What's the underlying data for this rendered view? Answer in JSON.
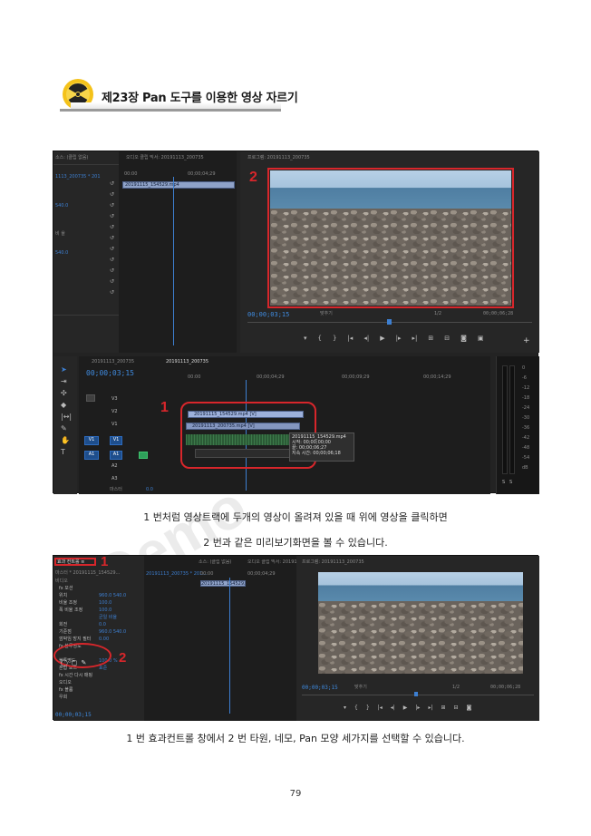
{
  "chapter": {
    "title": "제23장 Pan 도구를 이용한 영상 자르기"
  },
  "screenshot1": {
    "source_panel_tab": "소스: (클립 없음)",
    "audio_mixer_tab": "오디오 클립 믹서: 20191113_200735",
    "program_tab": "프로그램: 20191113_200735",
    "left_list": [
      "1113_200735 * 201",
      "540.0",
      "비 율",
      "540.0"
    ],
    "mini_ruler": [
      "00:00",
      "00;00;04;29"
    ],
    "mini_clip": "20191115_154529.mp4",
    "program_timecode": "00;00;03;15",
    "program_fit": "맞추기",
    "program_res": "1/2",
    "program_duration": "00;00;06;28",
    "timeline_tabs": [
      "20191113_200735",
      "20191113_200735"
    ],
    "timeline_timecode": "00;00;03;15",
    "ruler": [
      "00:00",
      "00;00;04;29",
      "00;00;09;29",
      "00;00;14;29"
    ],
    "tracks": [
      {
        "name": "V3",
        "src": ""
      },
      {
        "name": "V2",
        "src": ""
      },
      {
        "name": "V1",
        "src": "V1"
      },
      {
        "name": "A1",
        "src": "A1"
      },
      {
        "name": "A2",
        "src": ""
      },
      {
        "name": "A3",
        "src": ""
      }
    ],
    "master_label": "마스터",
    "master_value": "0.0",
    "clip_v2": "20191115_154529.mp4 [V]",
    "clip_v1": "20191113_200735.mp4 [V]",
    "tooltip": [
      "20191115_154529.mp4",
      "시작: 00;00;00;00",
      "끝: 00;00;06;27",
      "지속 시간: 00;00;06;18"
    ],
    "meter_scale": [
      "0",
      "-6",
      "-12",
      "-18",
      "-24",
      "-30",
      "-36",
      "-42",
      "-48",
      "-54",
      "dB"
    ],
    "meter_sr": [
      "S",
      "S"
    ],
    "label_1": "1",
    "label_2": "2"
  },
  "caption1_line1": "1 번처럼 영상트랙에 두개의 영상이 올려져 있을 때 위에 영상을 클릭하면",
  "caption1_line2": "2 번과 같은 미리보기화면을 볼 수 있습니다.",
  "screenshot2": {
    "effect_tab": "효과 컨트롤 ≡",
    "source_tab": "소스: (클립 없음)",
    "mixer_tab": "오디오 클립 믹서: 20191113_200735",
    "program_tab": "프로그램: 20191113_200735",
    "clip_path": "마스터 * 20191115_154529...",
    "sequence_path": "20191113_200735 * 201...",
    "ruler": [
      "00:00",
      "00;00;04;29"
    ],
    "clip_name": "20191115_154529.mp4",
    "section_video": "비디오",
    "rows": [
      {
        "label": "fx 모션",
        "value": ""
      },
      {
        "label": "위치",
        "value": "960.0  540.0"
      },
      {
        "label": "비율 조정",
        "value": "100.0"
      },
      {
        "label": "폭 비율 조정",
        "value": "100.0"
      },
      {
        "label": "",
        "value": "균일 비율"
      },
      {
        "label": "회전",
        "value": "0.0"
      },
      {
        "label": "기준점",
        "value": "960.0  540.0"
      },
      {
        "label": "깜박임 방지 필터",
        "value": "0.00"
      },
      {
        "label": "fx 불투명도",
        "value": ""
      },
      {
        "label": "",
        "value": ""
      },
      {
        "label": "불투명도",
        "value": "100.0 %"
      },
      {
        "label": "혼합 모드",
        "value": "표준"
      },
      {
        "label": "fx 시간 다시 매핑",
        "value": ""
      },
      {
        "label": "오디오",
        "value": ""
      },
      {
        "label": "fx 볼륨",
        "value": ""
      },
      {
        "label": "우회",
        "value": ""
      }
    ],
    "bottom_timecode": "00;00;03;15",
    "program_timecode": "00;00;03;15",
    "program_fit": "맞추기",
    "program_res": "1/2",
    "program_duration": "00;00;06;28",
    "label_1": "1",
    "label_2": "2"
  },
  "caption2": "1 번 효과컨트롤 창에서 2 번 타원, 네모, Pan 모양 세가지를 선택할 수 있습니다.",
  "page_number": "79",
  "watermark": "Demo"
}
